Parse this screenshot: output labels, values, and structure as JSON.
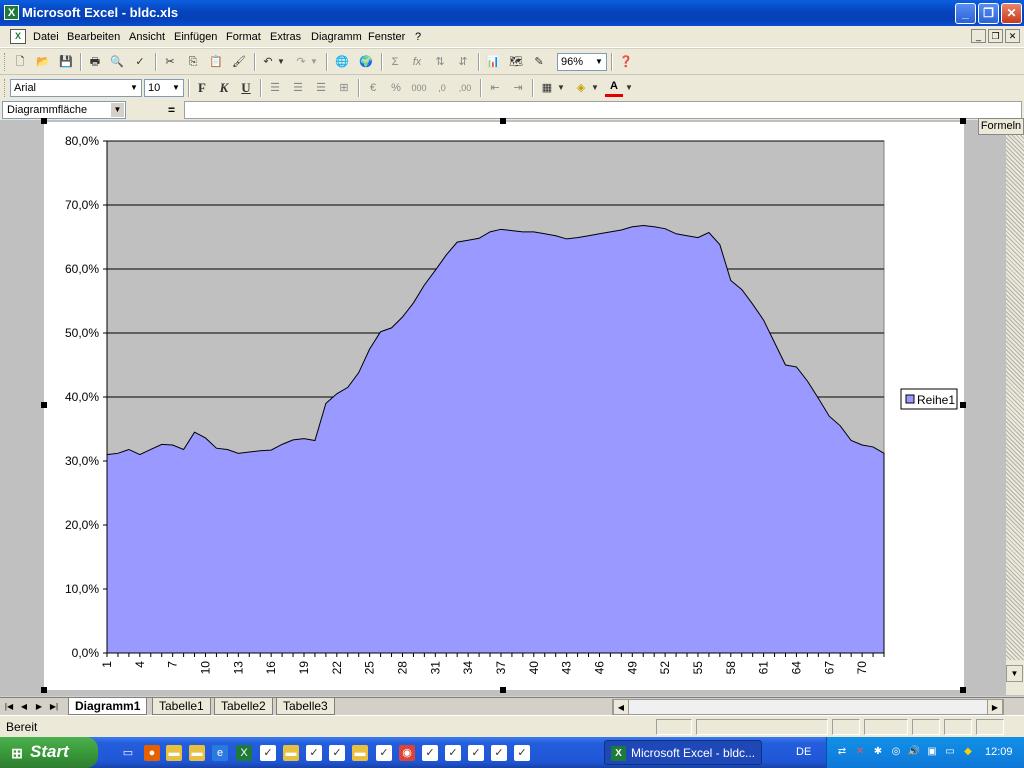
{
  "window": {
    "title": "Microsoft Excel - bldc.xls"
  },
  "menu": {
    "items": [
      "Datei",
      "Bearbeiten",
      "Ansicht",
      "Einfügen",
      "Format",
      "Extras",
      "Diagramm",
      "Fenster",
      "?"
    ]
  },
  "toolbar_standard": {
    "zoom": "96%"
  },
  "toolbar_format": {
    "font": "Arial",
    "size": "10",
    "bold": "F",
    "italic": "K",
    "underline": "U",
    "fontcolor": "A"
  },
  "formula_bar": {
    "name_box": "Diagrammfläche",
    "equals": "="
  },
  "floating": {
    "formeln": "Formeln"
  },
  "sheets": {
    "tabs": [
      "Diagramm1",
      "Tabelle1",
      "Tabelle2",
      "Tabelle3"
    ],
    "active": "Diagramm1"
  },
  "status": {
    "text": "Bereit"
  },
  "taskbar": {
    "start": "Start",
    "task_item": "Microsoft Excel - bldc...",
    "lang": "DE",
    "clock": "12:09"
  },
  "colors": {
    "plot_bg": "#C0C0C0",
    "area_fill": "#9999FF",
    "title_bar": "#0A5FE0",
    "taskbar": "#245EDC"
  },
  "chart_data": {
    "type": "area",
    "x": [
      1,
      2,
      3,
      4,
      5,
      6,
      7,
      8,
      9,
      10,
      11,
      12,
      13,
      14,
      15,
      16,
      17,
      18,
      19,
      20,
      21,
      22,
      23,
      24,
      25,
      26,
      27,
      28,
      29,
      30,
      31,
      32,
      33,
      34,
      35,
      36,
      37,
      38,
      39,
      40,
      41,
      42,
      43,
      44,
      45,
      46,
      47,
      48,
      49,
      50,
      51,
      52,
      53,
      54,
      55,
      56,
      57,
      58,
      59,
      60,
      61,
      62,
      63,
      64,
      65,
      66,
      67,
      68,
      69,
      70,
      71,
      72
    ],
    "x_tick_labels": [
      "1",
      "4",
      "7",
      "10",
      "13",
      "16",
      "19",
      "22",
      "25",
      "28",
      "31",
      "34",
      "37",
      "40",
      "43",
      "46",
      "49",
      "52",
      "55",
      "58",
      "61",
      "64",
      "67",
      "70"
    ],
    "series": [
      {
        "name": "Reihe1",
        "values": [
          0.31,
          0.312,
          0.318,
          0.31,
          0.318,
          0.326,
          0.325,
          0.318,
          0.345,
          0.336,
          0.32,
          0.318,
          0.312,
          0.314,
          0.316,
          0.317,
          0.326,
          0.333,
          0.335,
          0.332,
          0.39,
          0.405,
          0.415,
          0.438,
          0.475,
          0.502,
          0.508,
          0.525,
          0.547,
          0.575,
          0.598,
          0.622,
          0.642,
          0.645,
          0.648,
          0.658,
          0.662,
          0.66,
          0.658,
          0.658,
          0.655,
          0.652,
          0.647,
          0.649,
          0.652,
          0.655,
          0.658,
          0.661,
          0.666,
          0.668,
          0.666,
          0.663,
          0.655,
          0.652,
          0.649,
          0.657,
          0.638,
          0.582,
          0.568,
          0.545,
          0.52,
          0.485,
          0.45,
          0.447,
          0.425,
          0.398,
          0.37,
          0.355,
          0.332,
          0.325,
          0.322,
          0.312
        ]
      }
    ],
    "y_tick_labels": [
      "0,0%",
      "10,0%",
      "20,0%",
      "30,0%",
      "40,0%",
      "50,0%",
      "60,0%",
      "70,0%",
      "80,0%"
    ],
    "ylim": [
      0,
      0.8
    ],
    "grid": true,
    "legend": "right"
  }
}
